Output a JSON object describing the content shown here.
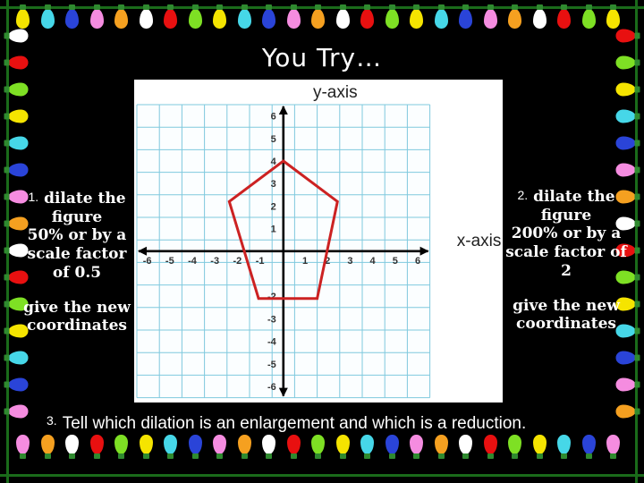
{
  "slide": {
    "title": "You Try…",
    "background_color": "#000000",
    "title_color": "#ffffff"
  },
  "border": {
    "name": "christmas-lights-border",
    "wire_color": "#1a6b1a",
    "bulb_colors": [
      "#f5e400",
      "#46d7e8",
      "#2a44d8",
      "#f58ce0",
      "#f5a020",
      "#ffffff",
      "#e81010",
      "#7ee024"
    ]
  },
  "tasks": {
    "left": {
      "number": "1.",
      "line1": "dilate the figure",
      "line2": "50% or by a scale factor of 0.5",
      "line3": "give the new coordinates"
    },
    "right": {
      "number": "2.",
      "line1": "dilate the figure",
      "line2": "200% or by a scale factor of 2",
      "line3": "give the new coordinates"
    },
    "bottom": {
      "number": "3.",
      "text": "Tell which dilation is an enlargement and which is a reduction."
    }
  },
  "chart_data": {
    "type": "scatter",
    "title": "",
    "xlabel": "x-axis",
    "ylabel": "y-axis",
    "xlim": [
      -6.5,
      6.5
    ],
    "ylim": [
      -6.5,
      6.5
    ],
    "grid": true,
    "grid_color": "#7fc9de",
    "axis_color": "#000000",
    "tick_label_color": "#333333",
    "xticks": [
      -6,
      -5,
      -4,
      -3,
      -2,
      -1,
      1,
      2,
      3,
      4,
      5,
      6
    ],
    "yticks": [
      6,
      5,
      4,
      3,
      2,
      1,
      -2,
      -3,
      -4,
      -5,
      -6
    ],
    "xtick_labels": [
      "-6",
      "-5",
      "-4",
      "-3",
      "-2",
      "-1",
      "1",
      "2",
      "3",
      "4",
      "5",
      "6"
    ],
    "ytick_labels": [
      "6",
      "5",
      "4",
      "3",
      "2",
      "1",
      "-2",
      "-3",
      "-4",
      "-5",
      "-6"
    ],
    "series": [
      {
        "name": "pentagon",
        "type": "polygon",
        "color": "#cc2222",
        "linewidth": 3,
        "closed": true,
        "points": [
          [
            0,
            4
          ],
          [
            2.4,
            2.2
          ],
          [
            1.5,
            -2.1
          ],
          [
            -1.1,
            -2.1
          ],
          [
            -2.4,
            2.2
          ]
        ]
      }
    ]
  }
}
